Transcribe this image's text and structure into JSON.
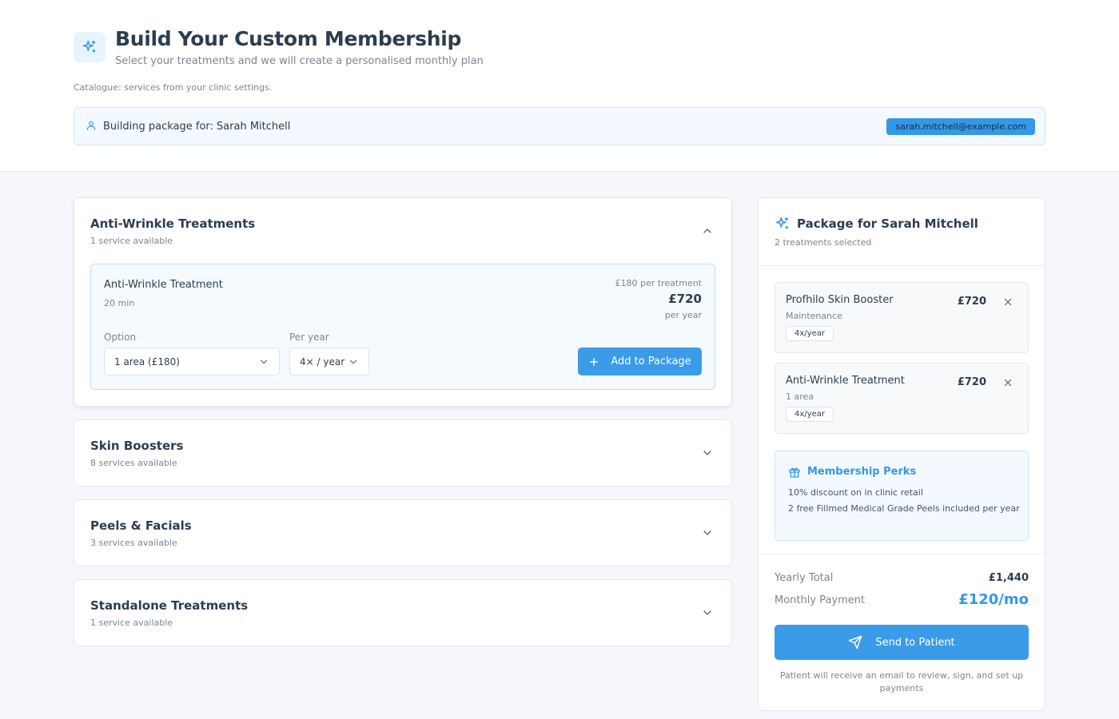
{
  "header": {
    "title": "Build Your Custom Membership",
    "subtitle": "Select your treatments and we will create a personalised monthly plan",
    "catalogue_note": "Catalogue: services from your clinic settings."
  },
  "patient": {
    "label": "Building package for:",
    "name": "Sarah Mitchell",
    "email": "sarah.mitchell@example.com"
  },
  "categories": [
    {
      "title": "Anti-Wrinkle Treatments",
      "count": "1 service available",
      "expanded": true,
      "service": {
        "name": "Anti-Wrinkle Treatment",
        "duration": "20 min",
        "per_treatment": "£180 per treatment",
        "price": "£720",
        "per_year": "per year",
        "option_label": "Option",
        "option_value": "1 area (£180)",
        "frequency_label": "Per year",
        "frequency_value": "4× / year",
        "add_label": "Add to Package"
      }
    },
    {
      "title": "Skin Boosters",
      "count": "8 services available",
      "expanded": false
    },
    {
      "title": "Peels & Facials",
      "count": "3 services available",
      "expanded": false
    },
    {
      "title": "Standalone Treatments",
      "count": "1 service available",
      "expanded": false
    }
  ],
  "package": {
    "title": "Package for Sarah Mitchell",
    "subtitle": "2 treatments selected",
    "items": [
      {
        "name": "Profhilo Skin Booster",
        "sub": "Maintenance",
        "freq": "4x/year",
        "price": "£720"
      },
      {
        "name": "Anti-Wrinkle Treatment",
        "sub": "1 area",
        "freq": "4x/year",
        "price": "£720"
      }
    ],
    "perks": {
      "title": "Membership Perks",
      "items": [
        "10% discount on in clinic retail",
        "2 free Fillmed Medical Grade Peels included per year"
      ]
    },
    "yearly_label": "Yearly Total",
    "yearly_value": "£1,440",
    "monthly_label": "Monthly Payment",
    "monthly_value": "£120/mo",
    "send_label": "Send to Patient",
    "send_note": "Patient will receive an email to review, sign, and set up payments"
  },
  "colors": {
    "accent": "#3498e8",
    "text": "#2c3e50",
    "muted": "#7a8694"
  },
  "icons": [
    "sparkles-icon",
    "user-icon",
    "chevron-up-icon",
    "chevron-down-icon",
    "plus-icon",
    "close-icon",
    "gift-icon",
    "send-icon"
  ]
}
